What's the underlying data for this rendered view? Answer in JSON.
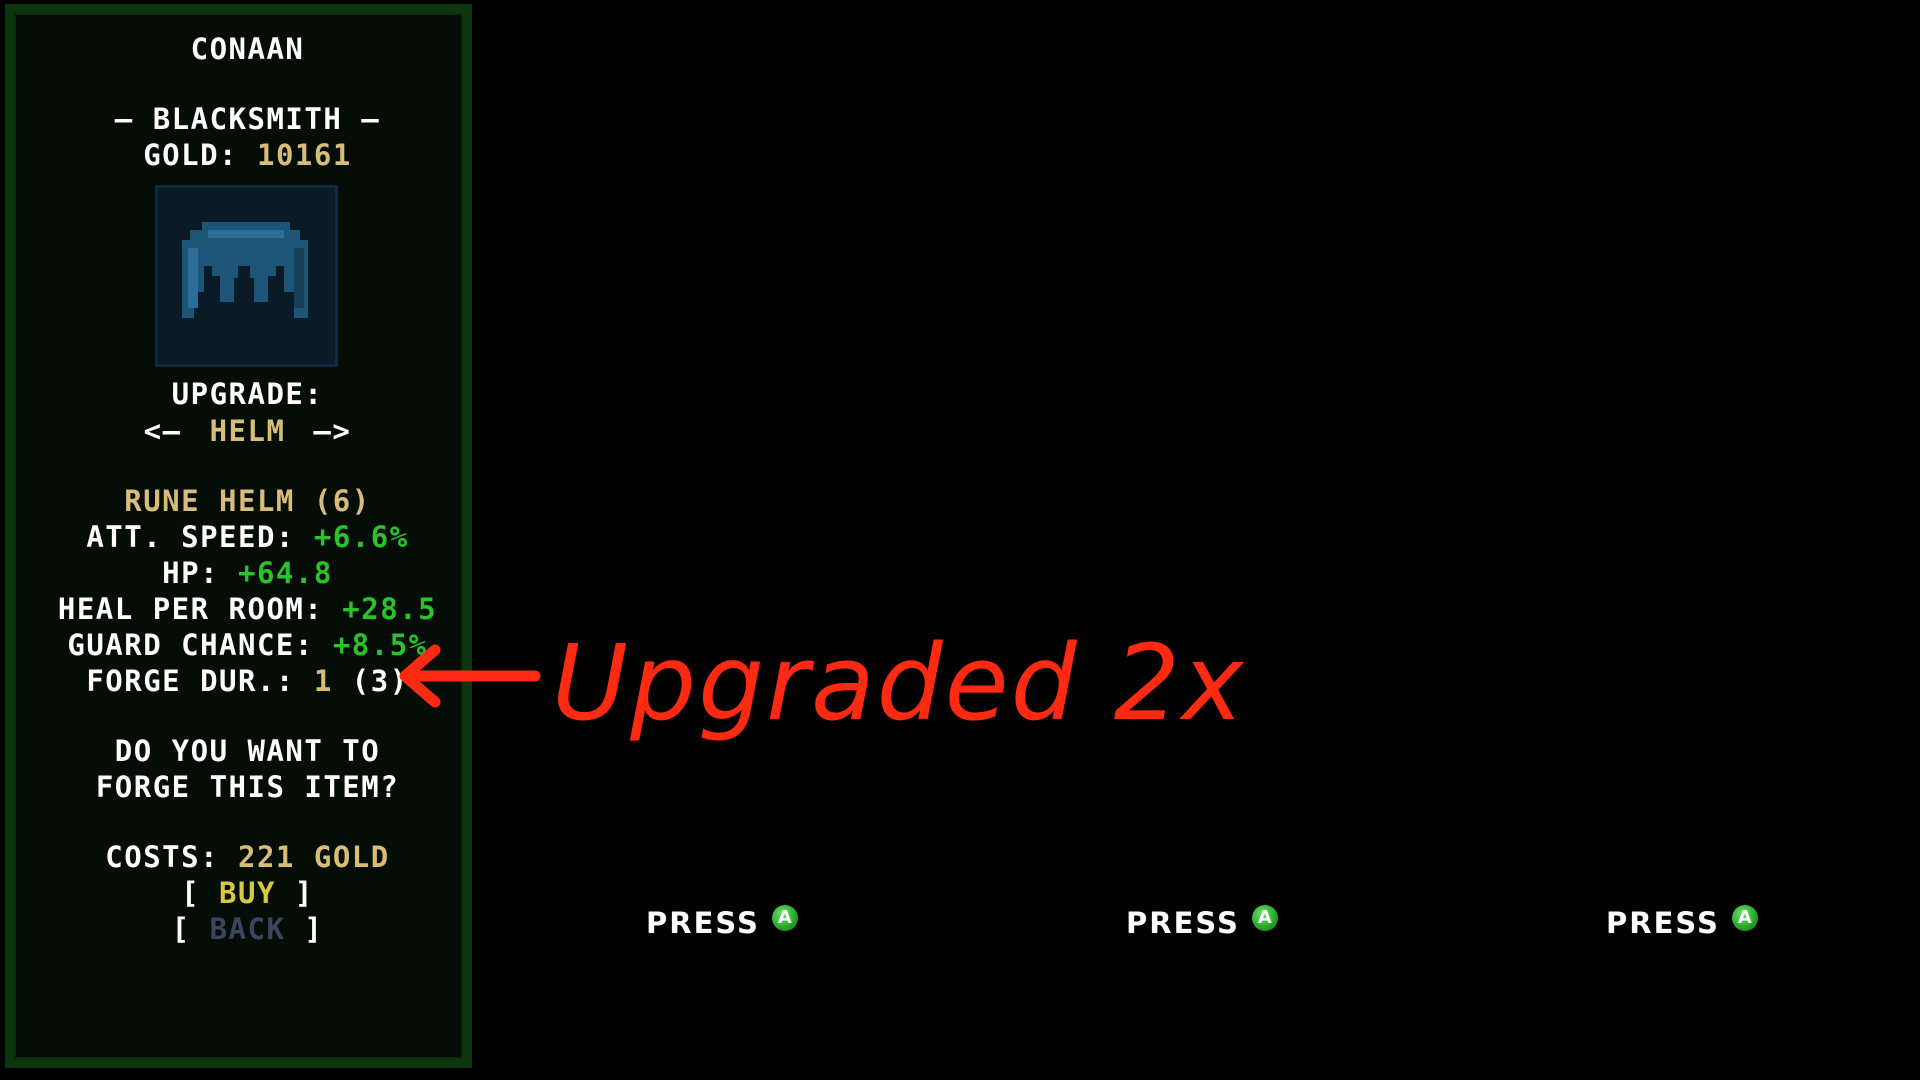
{
  "panel": {
    "character_name": "CONAAN",
    "shop_title": "– BLACKSMITH –",
    "gold_label": "GOLD:",
    "gold_value": "10161",
    "item_icon": "helm-icon",
    "upgrade_label": "UPGRADE:",
    "nav_left": "<–",
    "slot_name": "HELM",
    "nav_right": "–>",
    "item_name": "RUNE HELM (6)",
    "stats": [
      {
        "label": "ATT. SPEED:",
        "value": "+6.6%"
      },
      {
        "label": "HP:",
        "value": "+64.8"
      },
      {
        "label": "HEAL PER ROOM:",
        "value": "+28.5"
      },
      {
        "label": "GUARD CHANCE:",
        "value": "+8.5%"
      }
    ],
    "forge_label": "FORGE DUR.:",
    "forge_value": "1",
    "forge_max": "(3)",
    "question_line1": "DO YOU WANT TO",
    "question_line2": "FORGE THIS ITEM?",
    "costs_label": "COSTS:",
    "costs_value": "221 GOLD",
    "buy_open": "[",
    "buy_label": "BUY",
    "buy_close": "]",
    "back_open": "[",
    "back_label": "BACK",
    "back_close": "]"
  },
  "player_slots": [
    {
      "press_label": "PRESS",
      "button": "A"
    },
    {
      "press_label": "PRESS",
      "button": "A"
    },
    {
      "press_label": "PRESS",
      "button": "A"
    }
  ],
  "annotation": {
    "text": "Upgraded 2x",
    "color": "#ff2a12"
  },
  "colors": {
    "gold": "#d8bd78",
    "stat_green": "#2bc32b",
    "buy_yellow": "#d6c840",
    "back_dim": "#3a4660",
    "panel_border": "#0d360f"
  }
}
